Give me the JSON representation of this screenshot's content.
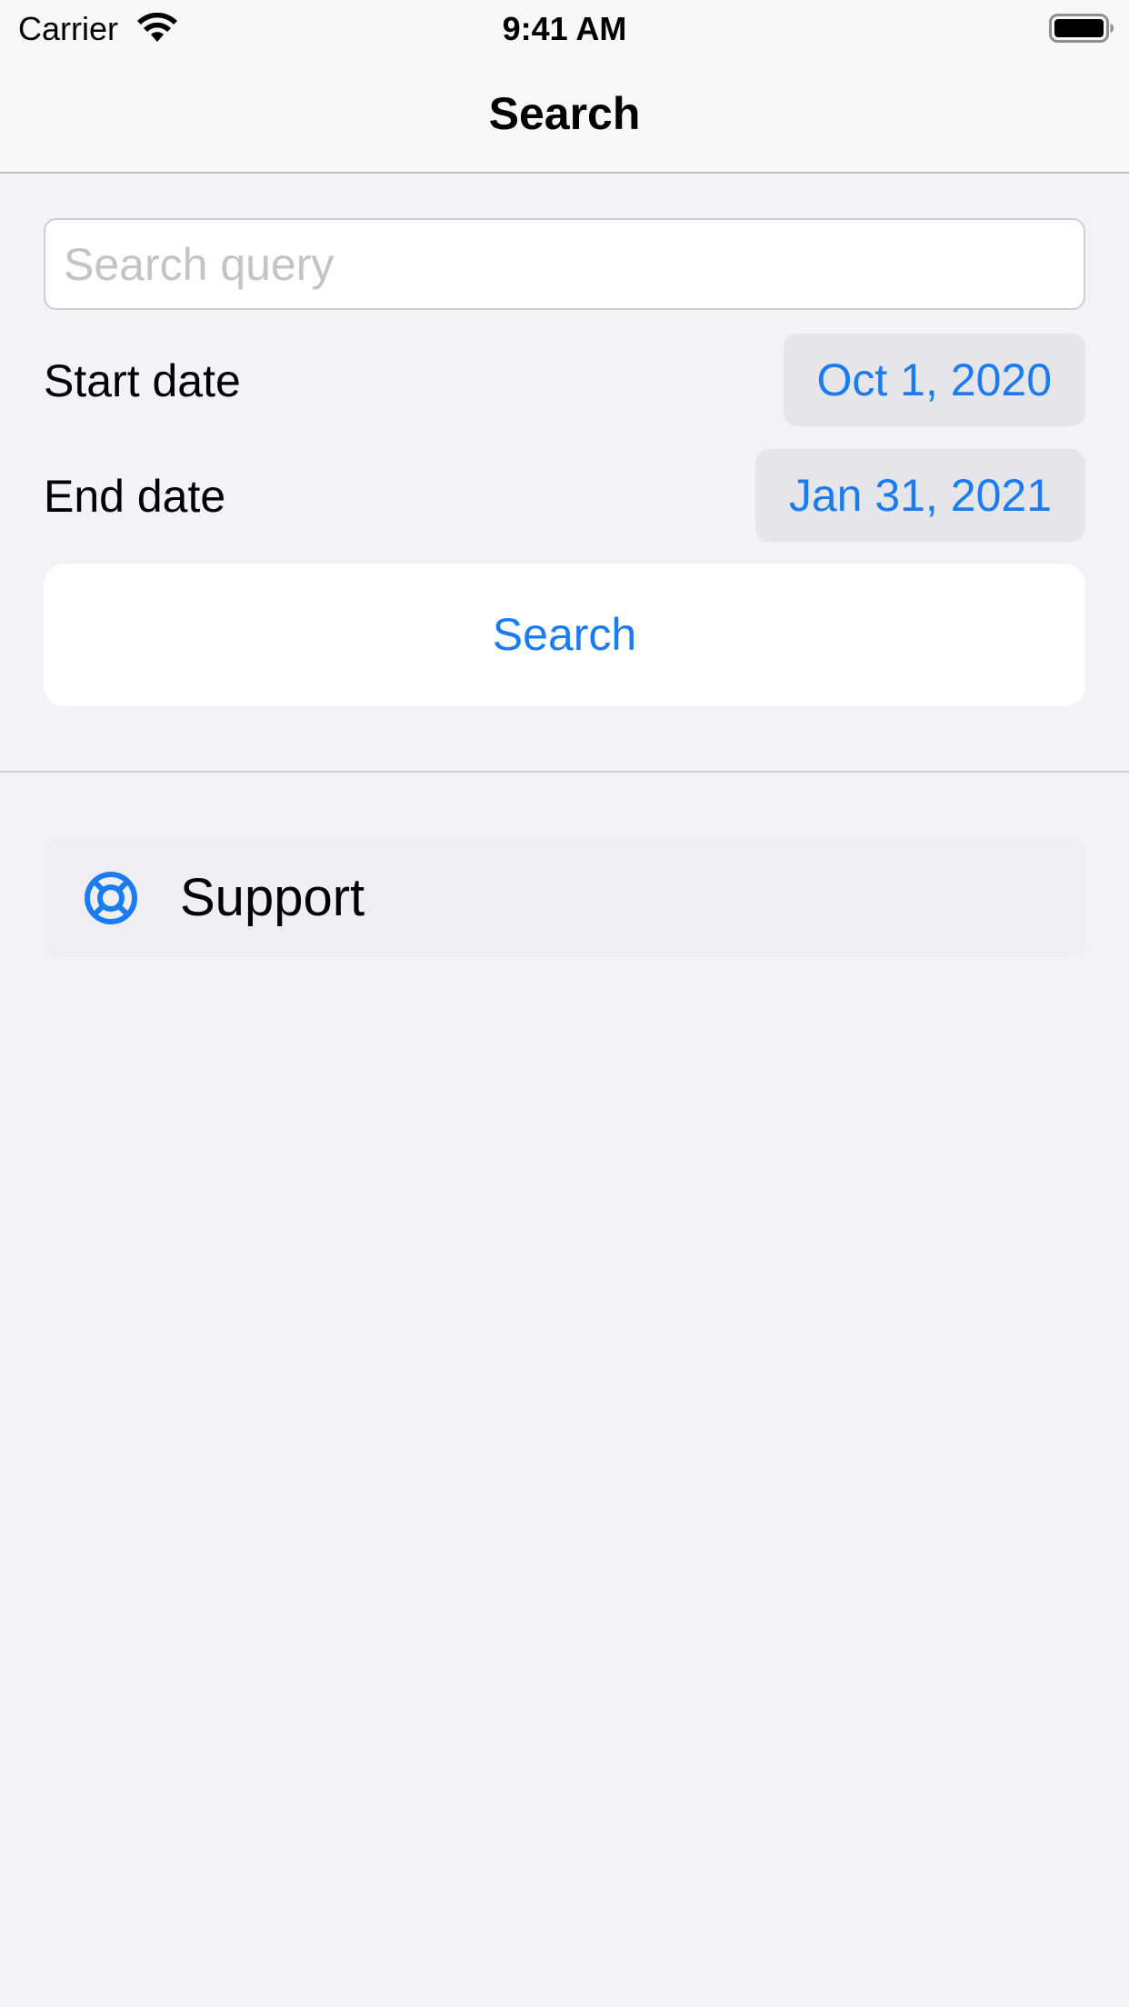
{
  "status_bar": {
    "carrier": "Carrier",
    "time": "9:41 AM",
    "wifi_icon": "wifi-icon",
    "battery_icon": "battery-icon"
  },
  "nav": {
    "title": "Search"
  },
  "form": {
    "query_placeholder": "Search query",
    "query_value": "",
    "start_date_label": "Start date",
    "start_date_value": "Oct 1, 2020",
    "end_date_label": "End date",
    "end_date_value": "Jan 31, 2021",
    "search_button_label": "Search"
  },
  "support": {
    "label": "Support",
    "icon": "lifebuoy-icon"
  },
  "colors": {
    "accent": "#1a7cf0",
    "background": "#f2f2f7",
    "pill_background": "#e5e5ea"
  }
}
